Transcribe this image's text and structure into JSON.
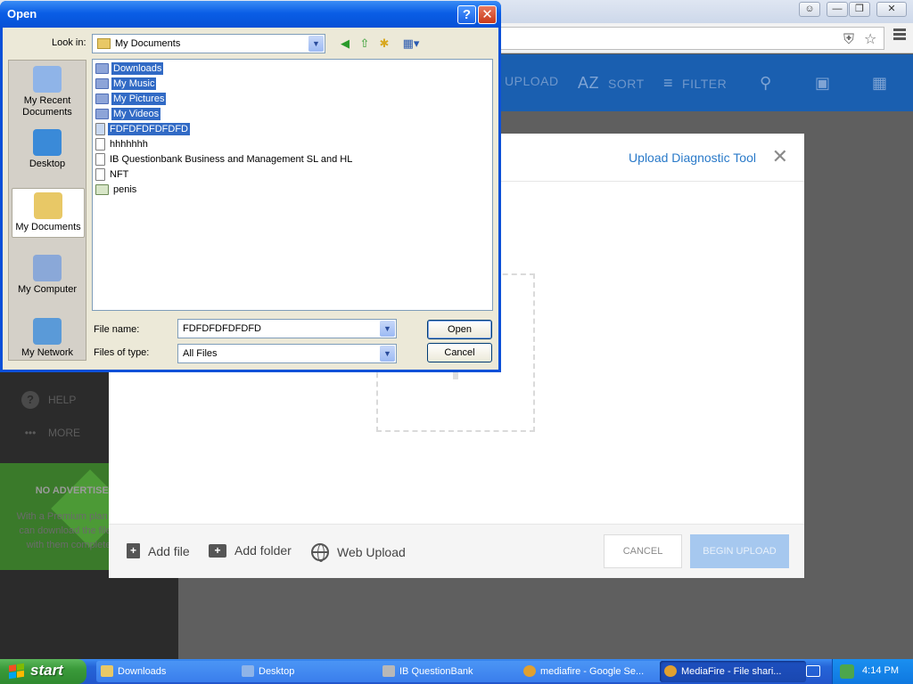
{
  "browser": {
    "tab_buttons": [
      "person-icon",
      "minimize-icon",
      "restore-icon",
      "close-icon"
    ],
    "menu_icon": "hamburger-menu-icon"
  },
  "mediafire": {
    "nav": [
      {
        "icon": "upload-icon",
        "label": "UPLOAD"
      },
      {
        "icon": "sort-az-icon",
        "label": "SORT",
        "icon_text": "AZ"
      },
      {
        "icon": "filter-icon",
        "label": "FILTER"
      }
    ],
    "sidebar": {
      "help": "HELP",
      "more": "MORE",
      "promo_title": "NO ADVERTISEMENTS",
      "promo_text": "With a Premium plan, your friends can download the files you share with them completely ad-free."
    },
    "upload_dialog": {
      "diagnostic_link": "Upload Diagnostic Tool",
      "close_symbol": "✕",
      "add_file": "Add file",
      "add_folder": "Add folder",
      "web_upload": "Web Upload",
      "cancel": "CANCEL",
      "begin_upload": "BEGIN UPLOAD"
    }
  },
  "open_dialog": {
    "title": "Open",
    "look_in_label": "Look in:",
    "look_in_value": "My Documents",
    "places": [
      "My Recent Documents",
      "Desktop",
      "My Documents",
      "My Computer",
      "My Network"
    ],
    "files": [
      {
        "name": "Downloads",
        "type": "folder",
        "selected": true
      },
      {
        "name": "My Music",
        "type": "folder",
        "selected": true
      },
      {
        "name": "My Pictures",
        "type": "folder",
        "selected": true
      },
      {
        "name": "My Videos",
        "type": "folder",
        "selected": true
      },
      {
        "name": "FDFDFDFDFDFD",
        "type": "doc",
        "selected": true
      },
      {
        "name": "hhhhhhh",
        "type": "doc",
        "selected": false
      },
      {
        "name": "IB Questionbank Business and Management SL and HL",
        "type": "doc",
        "selected": false
      },
      {
        "name": "NFT",
        "type": "doc",
        "selected": false
      },
      {
        "name": "penis",
        "type": "img",
        "selected": false
      }
    ],
    "file_name_label": "File name:",
    "file_name_value": "FDFDFDFDFDFD",
    "files_of_type_label": "Files of type:",
    "files_of_type_value": "All Files",
    "open_button": "Open",
    "cancel_button": "Cancel"
  },
  "taskbar": {
    "start": "start",
    "tasks": [
      {
        "label": "Downloads",
        "active": false
      },
      {
        "label": "Desktop",
        "active": false
      },
      {
        "label": "IB QuestionBank",
        "active": false
      },
      {
        "label": "mediafire - Google Se...",
        "active": false
      },
      {
        "label": "MediaFire - File shari...",
        "active": true
      }
    ],
    "clock": "4:14 PM"
  }
}
